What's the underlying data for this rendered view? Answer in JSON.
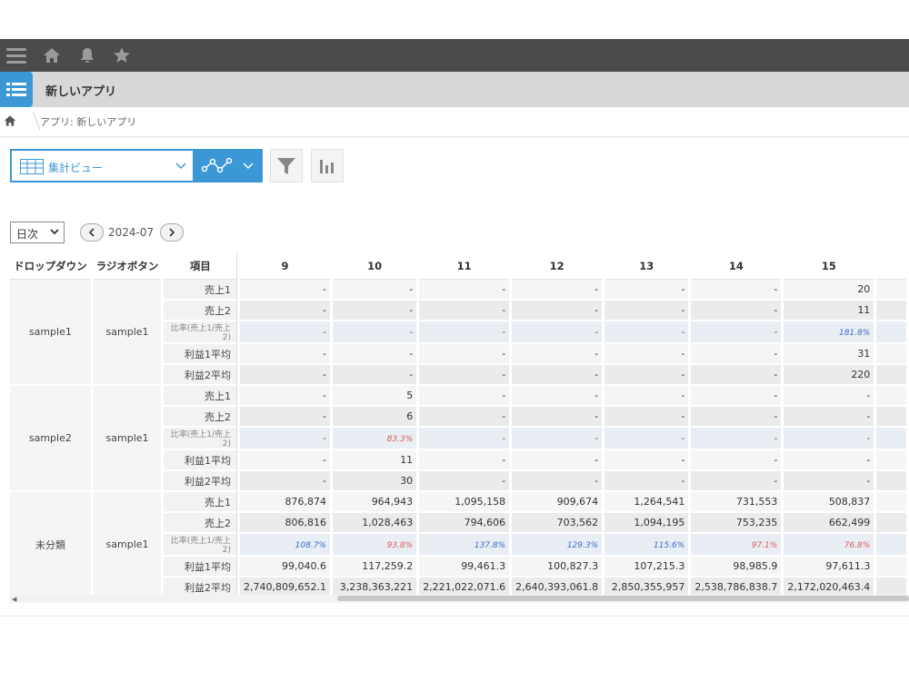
{
  "app": {
    "title": "新しいアプリ"
  },
  "breadcrumb": {
    "text": "アプリ: 新しいアプリ"
  },
  "view": {
    "selected": "集計ビュー"
  },
  "period": {
    "selected": "日次",
    "month": "2024-07"
  },
  "table": {
    "headers": {
      "dropdown": "ドロップダウン",
      "radio": "ラジオボタン",
      "item": "項目"
    },
    "columns": [
      "9",
      "10",
      "11",
      "12",
      "13",
      "14",
      "15"
    ],
    "groups": [
      {
        "dropdown": "sample1",
        "radio": "sample1",
        "rows": [
          {
            "label": "売上1",
            "values": [
              "-",
              "-",
              "-",
              "-",
              "-",
              "-",
              "20"
            ]
          },
          {
            "label": "売上2",
            "values": [
              "-",
              "-",
              "-",
              "-",
              "-",
              "-",
              "11"
            ]
          },
          {
            "label": "比率(売上1/売上2)",
            "values": [
              "-",
              "-",
              "-",
              "-",
              "-",
              "-",
              "181.8%"
            ],
            "colors": [
              "",
              "",
              "",
              "",
              "",
              "",
              "blue"
            ]
          },
          {
            "label": "利益1平均",
            "values": [
              "-",
              "-",
              "-",
              "-",
              "-",
              "-",
              "31"
            ]
          },
          {
            "label": "利益2平均",
            "values": [
              "-",
              "-",
              "-",
              "-",
              "-",
              "-",
              "220"
            ]
          }
        ]
      },
      {
        "dropdown": "sample2",
        "radio": "sample1",
        "rows": [
          {
            "label": "売上1",
            "values": [
              "-",
              "5",
              "-",
              "-",
              "-",
              "-",
              "-"
            ]
          },
          {
            "label": "売上2",
            "values": [
              "-",
              "6",
              "-",
              "-",
              "-",
              "-",
              "-"
            ]
          },
          {
            "label": "比率(売上1/売上2)",
            "values": [
              "-",
              "83.3%",
              "-",
              "-",
              "-",
              "-",
              "-"
            ],
            "colors": [
              "",
              "red",
              "",
              "",
              "",
              "",
              ""
            ]
          },
          {
            "label": "利益1平均",
            "values": [
              "-",
              "11",
              "-",
              "-",
              "-",
              "-",
              "-"
            ]
          },
          {
            "label": "利益2平均",
            "values": [
              "-",
              "30",
              "-",
              "-",
              "-",
              "-",
              "-"
            ]
          }
        ]
      },
      {
        "dropdown": "未分類",
        "radio": "sample1",
        "rows": [
          {
            "label": "売上1",
            "values": [
              "876,874",
              "964,943",
              "1,095,158",
              "909,674",
              "1,264,541",
              "731,553",
              "508,837"
            ]
          },
          {
            "label": "売上2",
            "values": [
              "806,816",
              "1,028,463",
              "794,606",
              "703,562",
              "1,094,195",
              "753,235",
              "662,499"
            ]
          },
          {
            "label": "比率(売上1/売上2)",
            "values": [
              "108.7%",
              "93.8%",
              "137.8%",
              "129.3%",
              "115.6%",
              "97.1%",
              "76.8%"
            ],
            "colors": [
              "blue",
              "red",
              "blue",
              "blue",
              "blue",
              "red",
              "red"
            ]
          },
          {
            "label": "利益1平均",
            "values": [
              "99,040.6",
              "117,259.2",
              "99,461.3",
              "100,827.3",
              "107,215.3",
              "98,985.9",
              "97,611.3"
            ]
          },
          {
            "label": "利益2平均",
            "values": [
              "2,740,809,652.1",
              "3,238,363,221",
              "2,221,022,071.6",
              "2,640,393,061.8",
              "2,850,355,957",
              "2,538,786,838.7",
              "2,172,020,463.4"
            ]
          }
        ]
      }
    ]
  },
  "colors": {
    "accent": "#3b97d6",
    "topbar": "#4b4b4b",
    "blue_ratio": "#3a6bc9",
    "red_ratio": "#e05b5b"
  }
}
